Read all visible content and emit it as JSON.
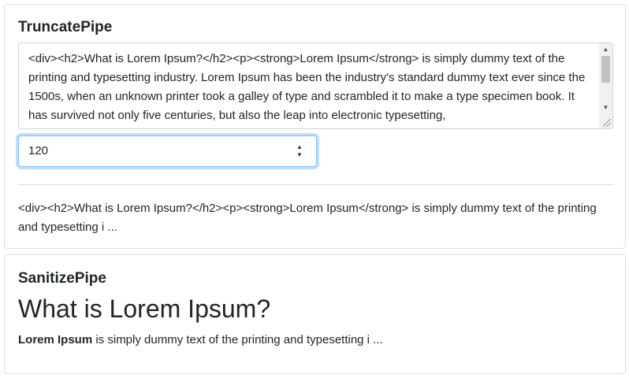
{
  "truncate_card": {
    "title": "TruncatePipe",
    "textarea_value": "<div><h2>What is Lorem Ipsum?</h2><p><strong>Lorem Ipsum</strong> is simply dummy text of the printing and typesetting industry. Lorem Ipsum has been the industry's standard dummy text ever since the 1500s, when an unknown printer took a galley of type and scrambled it to make a type specimen book. It has survived not only five centuries, but also the leap into electronic typesetting,",
    "length_value": "120",
    "output": "<div><h2>What is Lorem Ipsum?</h2><p><strong>Lorem Ipsum</strong> is simply dummy text of the printing and typesetting i ..."
  },
  "sanitize_card": {
    "title": "SanitizePipe",
    "heading": "What is Lorem Ipsum?",
    "strong_text": "Lorem Ipsum",
    "paragraph_rest": " is simply dummy text of the printing and typesetting i ..."
  },
  "icons": {
    "scroll_up": "triangle-up",
    "scroll_down": "triangle-down",
    "spinner": "up-down-arrows"
  },
  "colors": {
    "focus_border": "#80bdff",
    "text": "#212529"
  }
}
